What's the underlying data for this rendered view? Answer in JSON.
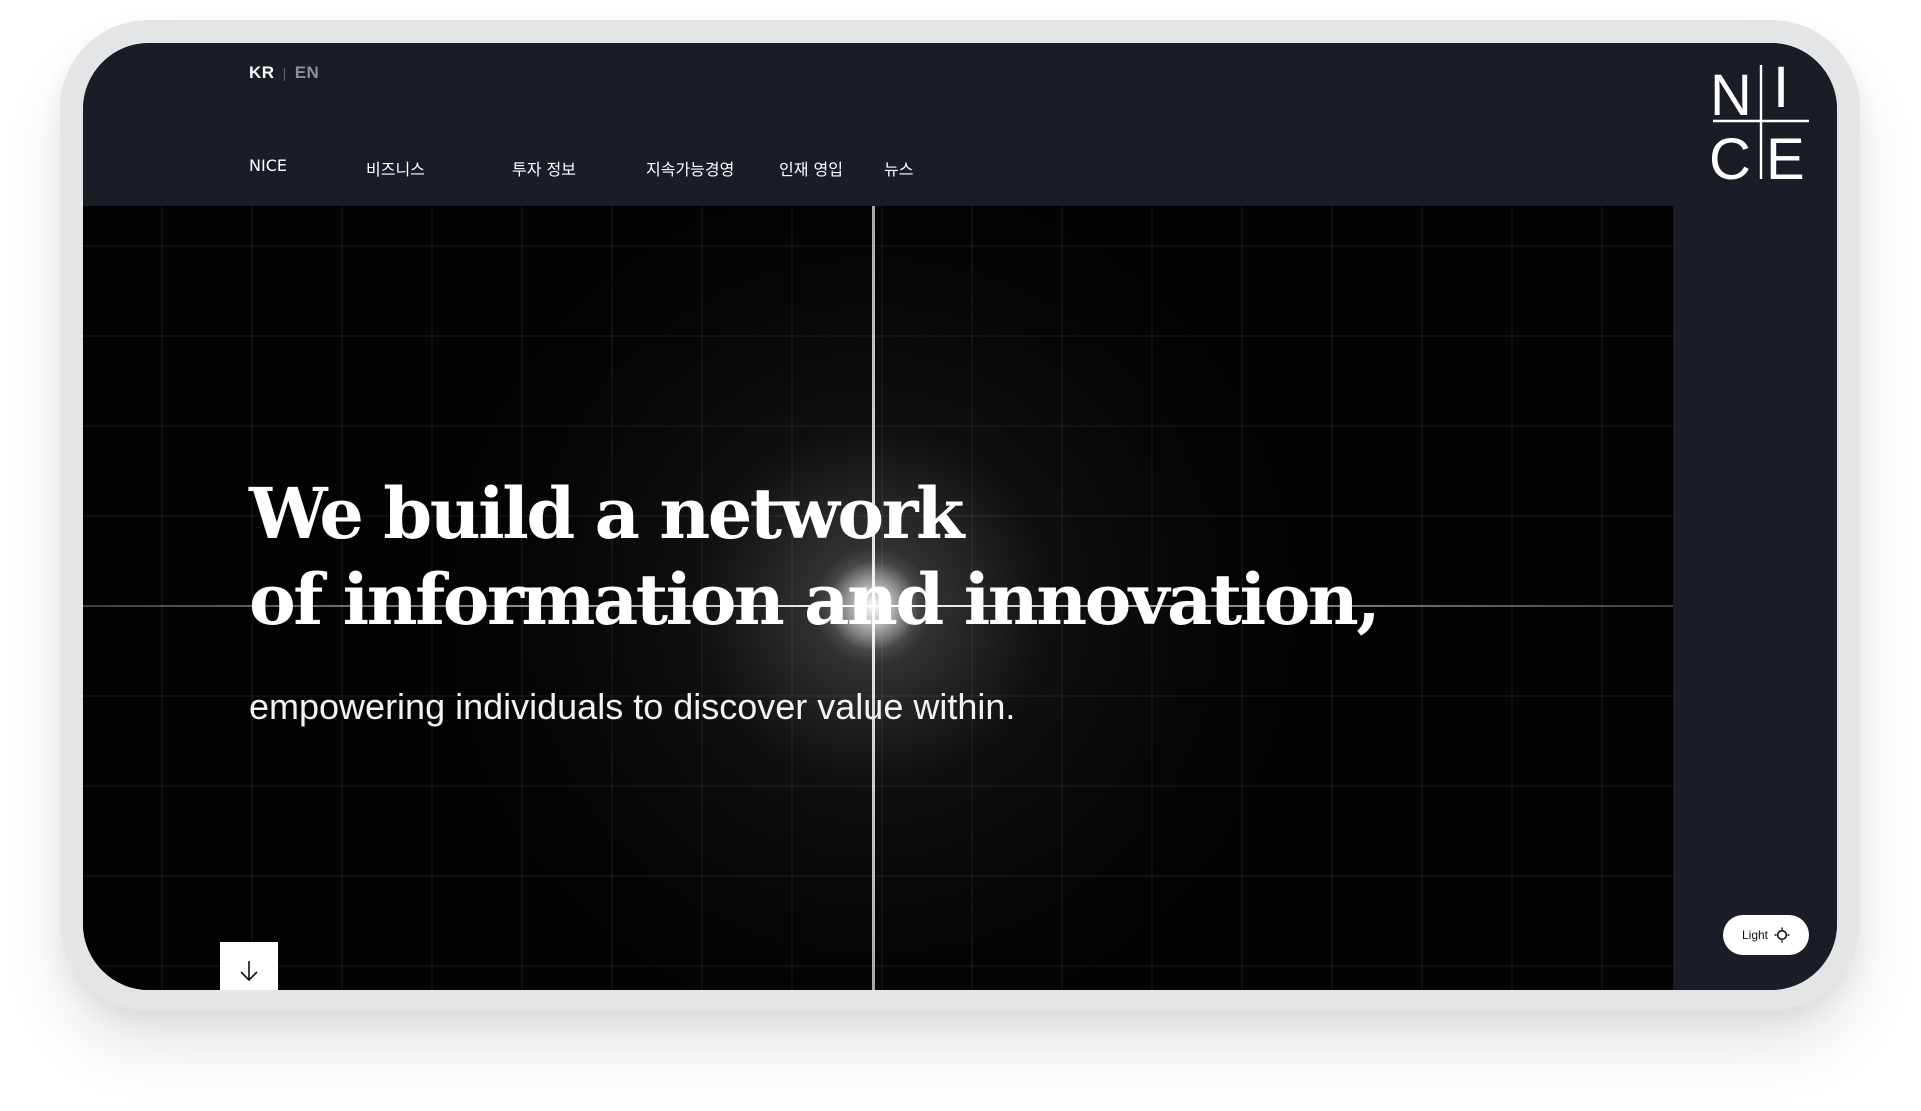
{
  "header": {
    "languages": {
      "active": "KR",
      "separator": "|",
      "inactive": "EN"
    },
    "nav": [
      {
        "label": "NICE"
      },
      {
        "label": "비즈니스"
      },
      {
        "label": "투자 정보"
      },
      {
        "label": "지속가능경영"
      },
      {
        "label": "인재 영입"
      },
      {
        "label": "뉴스"
      }
    ]
  },
  "brand": {
    "logo_letters": [
      "N",
      "I",
      "C",
      "E"
    ]
  },
  "hero": {
    "headline_line1": "We build a network",
    "headline_line2": "of information and innovation,",
    "subline": "empowering individuals to discover value within.",
    "scroll_icon": "arrow-down-icon"
  },
  "theme": {
    "label": "Light",
    "icon": "sun-icon"
  },
  "colors": {
    "header_bg": "#1a1d26",
    "hero_bg": "#030303",
    "text": "#ffffff",
    "frame": "#e4e5e7"
  }
}
